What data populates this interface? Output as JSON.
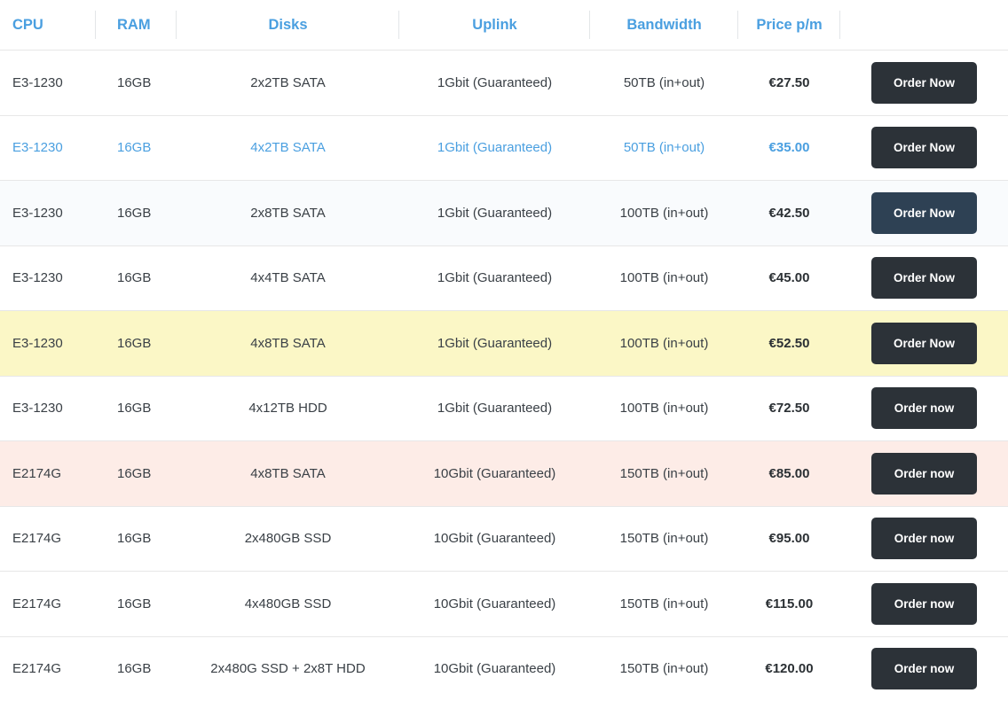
{
  "table": {
    "columns": [
      {
        "key": "cpu",
        "label": "CPU"
      },
      {
        "key": "ram",
        "label": "RAM"
      },
      {
        "key": "disks",
        "label": "Disks"
      },
      {
        "key": "uplink",
        "label": "Uplink"
      },
      {
        "key": "bandwidth",
        "label": "Bandwidth"
      },
      {
        "key": "price",
        "label": "Price p/m"
      },
      {
        "key": "action",
        "label": ""
      }
    ],
    "colors": {
      "header_text": "#4a9fe0",
      "row_text": "#3a4046",
      "link_row_text": "#4a9fe0",
      "row_highlight_bg": "#fbf7c6",
      "row_alert_bg": "#fdece7",
      "row_tint_bg": "#f9fbfd",
      "button_bg": "#2c3238",
      "button_bg_navy": "#2e4154",
      "button_text": "#ffffff",
      "row_divider": "#e7e7e7"
    },
    "rows": [
      {
        "cpu": "E3-1230",
        "ram": "16GB",
        "disks": "2x2TB SATA",
        "uplink": "1Gbit (Guaranteed)",
        "bandwidth": "50TB (in+out)",
        "price": "€27.50",
        "action": "Order Now",
        "style": "row-default",
        "button_style": "dark"
      },
      {
        "cpu": "E3-1230",
        "ram": "16GB",
        "disks": "4x2TB SATA",
        "uplink": "1Gbit (Guaranteed)",
        "bandwidth": "50TB (in+out)",
        "price": "€35.00",
        "action": "Order Now",
        "style": "row-blue",
        "button_style": "dark"
      },
      {
        "cpu": "E3-1230",
        "ram": "16GB",
        "disks": "2x8TB SATA",
        "uplink": "1Gbit (Guaranteed)",
        "bandwidth": "100TB (in+out)",
        "price": "€42.50",
        "action": "Order Now",
        "style": "row-tint",
        "button_style": "navy"
      },
      {
        "cpu": "E3-1230",
        "ram": "16GB",
        "disks": "4x4TB SATA",
        "uplink": "1Gbit (Guaranteed)",
        "bandwidth": "100TB (in+out)",
        "price": "€45.00",
        "action": "Order Now",
        "style": "row-default",
        "button_style": "dark"
      },
      {
        "cpu": "E3-1230",
        "ram": "16GB",
        "disks": "4x8TB SATA",
        "uplink": "1Gbit (Guaranteed)",
        "bandwidth": "100TB (in+out)",
        "price": "€52.50",
        "action": "Order Now",
        "style": "row-highlight",
        "button_style": "dark"
      },
      {
        "cpu": "E3-1230",
        "ram": "16GB",
        "disks": "4x12TB HDD",
        "uplink": "1Gbit (Guaranteed)",
        "bandwidth": "100TB (in+out)",
        "price": "€72.50",
        "action": "Order now",
        "style": "row-default",
        "button_style": "dark"
      },
      {
        "cpu": "E2174G",
        "ram": "16GB",
        "disks": "4x8TB SATA",
        "uplink": "10Gbit (Guaranteed)",
        "bandwidth": "150TB (in+out)",
        "price": "€85.00",
        "action": "Order now",
        "style": "row-alert",
        "button_style": "dark"
      },
      {
        "cpu": "E2174G",
        "ram": "16GB",
        "disks": "2x480GB SSD",
        "uplink": "10Gbit (Guaranteed)",
        "bandwidth": "150TB (in+out)",
        "price": "€95.00",
        "action": "Order now",
        "style": "row-default",
        "button_style": "dark"
      },
      {
        "cpu": "E2174G",
        "ram": "16GB",
        "disks": "4x480GB SSD",
        "uplink": "10Gbit (Guaranteed)",
        "bandwidth": "150TB (in+out)",
        "price": "€115.00",
        "action": "Order now",
        "style": "row-default",
        "button_style": "dark"
      },
      {
        "cpu": "E2174G",
        "ram": "16GB",
        "disks": "2x480G SSD + 2x8T HDD",
        "uplink": "10Gbit (Guaranteed)",
        "bandwidth": "150TB (in+out)",
        "price": "€120.00",
        "action": "Order now",
        "style": "row-default",
        "button_style": "dark"
      }
    ]
  }
}
